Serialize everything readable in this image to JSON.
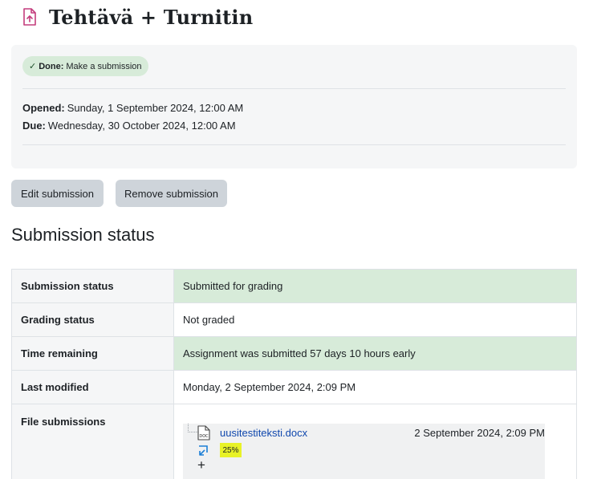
{
  "header": {
    "title": "Tehtävä + Turnitin",
    "icon": "assignment-upload-icon",
    "icon_color": "#c43d7d"
  },
  "activity_info": {
    "completion": {
      "check_icon": "✓",
      "status": "Done:",
      "text": "Make a submission"
    },
    "opened": {
      "label": "Opened:",
      "value": "Sunday, 1 September 2024, 12:00 AM"
    },
    "due": {
      "label": "Due:",
      "value": "Wednesday, 30 October 2024, 12:00 AM"
    }
  },
  "buttons": {
    "edit": "Edit submission",
    "remove": "Remove submission"
  },
  "section": {
    "title": "Submission status"
  },
  "status_table": {
    "rows": [
      {
        "label": "Submission status",
        "value": "Submitted for grading",
        "highlight": true
      },
      {
        "label": "Grading status",
        "value": "Not graded",
        "highlight": false
      },
      {
        "label": "Time remaining",
        "value": "Assignment was submitted 57 days 10 hours early",
        "highlight": true
      },
      {
        "label": "Last modified",
        "value": "Monday, 2 September 2024, 2:09 PM",
        "highlight": false
      }
    ],
    "files": {
      "label": "File submissions",
      "items": [
        {
          "name": "uusitestiteksti.docx",
          "date": "2 September 2024, 2:09 PM",
          "file_icon_text": "DOC",
          "similarity": "25%",
          "similarity_color": "#e8f227"
        }
      ],
      "expand_icon": "+"
    }
  },
  "colors": {
    "success_bg": "#d7ebd9",
    "link": "#0f47ad",
    "button_bg": "#ced4da"
  }
}
